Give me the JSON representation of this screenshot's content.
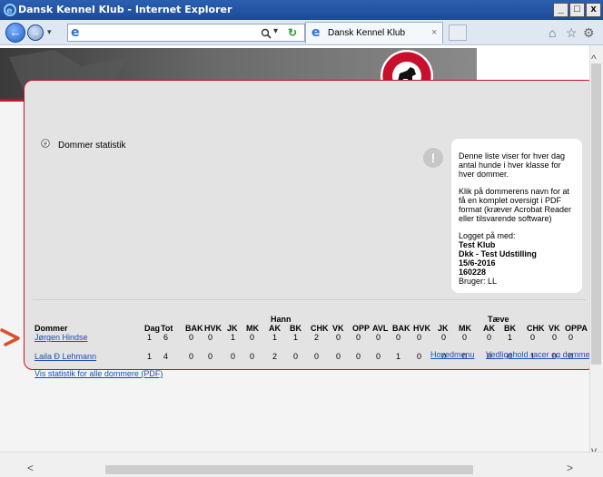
{
  "window": {
    "title": "Dansk Kennel Klub - Internet Explorer",
    "min": "_",
    "max": "□",
    "close": "x"
  },
  "browser": {
    "address_value": "",
    "tab_title": "Dansk Kennel Klub",
    "tab_close": "×"
  },
  "page": {
    "heading": "Dommer statistik",
    "info": {
      "p1": "Denne liste viser for hver dag antal hunde i hver klasse for hver dommer.",
      "p2": "Klik på dommerens navn for at få en komplet oversigt i PDF format (kræver Acrobat Reader eller tilsvarende software)",
      "logged_in": "Logget på med:",
      "club": "Test Klub",
      "event": "Dkk - Test Udstilling",
      "date": "15/6-2016",
      "number": "160228",
      "user": "Bruger: LL"
    },
    "table": {
      "group_male": "Hann",
      "group_female": "Tæve",
      "col_dommer": "Dommer",
      "col_dag": "Dag",
      "col_tot": "Tot",
      "male_cols": [
        "BAK",
        "HVK",
        "JK",
        "MK",
        "AK",
        "BK",
        "CHK",
        "VK",
        "OPP",
        "AVL"
      ],
      "female_cols": [
        "BAK",
        "HVK",
        "JK",
        "MK",
        "AK",
        "BK",
        "CHK",
        "VK",
        "OPPA"
      ],
      "rows": [
        {
          "name": "Jørgen Hindse",
          "dag": "1",
          "tot": "6",
          "male": [
            "0",
            "0",
            "1",
            "0",
            "1",
            "1",
            "2",
            "0",
            "0",
            "0"
          ],
          "female": [
            "0",
            "0",
            "0",
            "0",
            "0",
            "1",
            "0",
            "0",
            "0"
          ]
        },
        {
          "name": "Laila Ð Lehmann",
          "dag": "1",
          "tot": "4",
          "male": [
            "0",
            "0",
            "0",
            "0",
            "2",
            "0",
            "0",
            "0",
            "0",
            "0"
          ],
          "female": [
            "1",
            "0",
            "0",
            "0",
            "0",
            "0",
            "1",
            "0",
            "0"
          ]
        }
      ]
    },
    "pdf_link": "Vis statistik for alle dommere (PDF)",
    "footer_links": [
      "Hovedmenu",
      "Vedligehold racer og dommere"
    ]
  },
  "icons": [
    "ie-icon",
    "back-icon",
    "forward-icon",
    "search-icon",
    "refresh-icon",
    "home-icon",
    "star-icon",
    "gear-icon",
    "document-icon",
    "exclamation-icon",
    "arrow-pointer-icon"
  ],
  "colors": {
    "accent": "#c8102e",
    "link": "#1a4fb5"
  }
}
